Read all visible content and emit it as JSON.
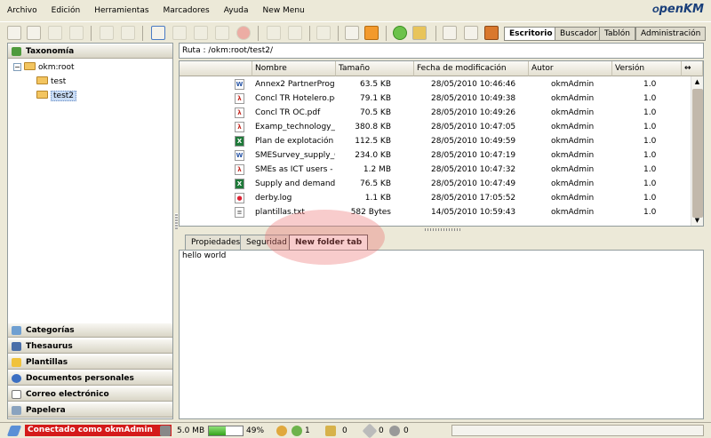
{
  "menu": [
    "Archivo",
    "Edición",
    "Herramientas",
    "Marcadores",
    "Ayuda",
    "New Menu"
  ],
  "logo": {
    "main": "penKM",
    "prefix": "O"
  },
  "workspace_tabs": [
    {
      "label": "Escritorio",
      "active": true
    },
    {
      "label": "Buscador",
      "active": false
    },
    {
      "label": "Tablón",
      "active": false
    },
    {
      "label": "Administración",
      "active": false
    }
  ],
  "left_panel": {
    "header": "Taxonomía",
    "tree": {
      "root": "okm:root",
      "children": [
        "test",
        "test2"
      ],
      "selected": "test2"
    },
    "bottom_sections": [
      "Categorías",
      "Thesaurus",
      "Plantillas",
      "Documentos personales",
      "Correo electrónico",
      "Papelera"
    ]
  },
  "path": "Ruta : /okm:root/test2/",
  "table": {
    "columns": [
      "Nombre",
      "Tamaño",
      "Fecha de modificación",
      "Autor",
      "Versión"
    ],
    "rows": [
      {
        "icon": "word",
        "name": "Annex2 PartnerProgre",
        "size": "63.5 KB",
        "date": "28/05/2010 10:46:46",
        "author": "okmAdmin",
        "version": "1.0"
      },
      {
        "icon": "pdf",
        "name": "Concl TR Hotelero.pdl",
        "size": "79.1 KB",
        "date": "28/05/2010 10:49:38",
        "author": "okmAdmin",
        "version": "1.0"
      },
      {
        "icon": "pdf",
        "name": "Concl TR OC.pdf",
        "size": "70.5 KB",
        "date": "28/05/2010 10:49:26",
        "author": "okmAdmin",
        "version": "1.0"
      },
      {
        "icon": "pdf",
        "name": "Examp_technology_m",
        "size": "380.8 KB",
        "date": "28/05/2010 10:47:05",
        "author": "okmAdmin",
        "version": "1.0"
      },
      {
        "icon": "excel",
        "name": "Plan de explotación C",
        "size": "112.5 KB",
        "date": "28/05/2010 10:49:59",
        "author": "okmAdmin",
        "version": "1.0"
      },
      {
        "icon": "word",
        "name": "SMESurvey_supply_G",
        "size": "234.0 KB",
        "date": "28/05/2010 10:47:19",
        "author": "okmAdmin",
        "version": "1.0"
      },
      {
        "icon": "pdf",
        "name": "SMEs as ICT users - s",
        "size": "1.2 MB",
        "date": "28/05/2010 10:47:32",
        "author": "okmAdmin",
        "version": "1.0"
      },
      {
        "icon": "excel",
        "name": "Supply and demand N",
        "size": "76.5 KB",
        "date": "28/05/2010 10:47:49",
        "author": "okmAdmin",
        "version": "1.0"
      },
      {
        "icon": "log",
        "name": "derby.log",
        "size": "1.1 KB",
        "date": "28/05/2010 17:05:52",
        "author": "okmAdmin",
        "version": "1.0"
      },
      {
        "icon": "txt",
        "name": "plantillas.txt",
        "size": "582 Bytes",
        "date": "14/05/2010 10:59:43",
        "author": "okmAdmin",
        "version": "1.0"
      }
    ]
  },
  "properties_tabs": [
    {
      "label": "Propiedades",
      "active": false
    },
    {
      "label": "Seguridad",
      "active": false
    },
    {
      "label": "New folder tab",
      "active": true
    }
  ],
  "tab_content": "hello world",
  "status": {
    "connected": "Conectado como okmAdmin",
    "disk_used": "5.0 MB",
    "quota_percent": 49,
    "quota_label": "49%",
    "users": "1",
    "locked": "0",
    "subscriptions": "0",
    "workflows": "0"
  },
  "colors": {
    "accent_red": "#d41a1a",
    "selection": "#c9dcf5",
    "background": "#ECE9D8"
  }
}
